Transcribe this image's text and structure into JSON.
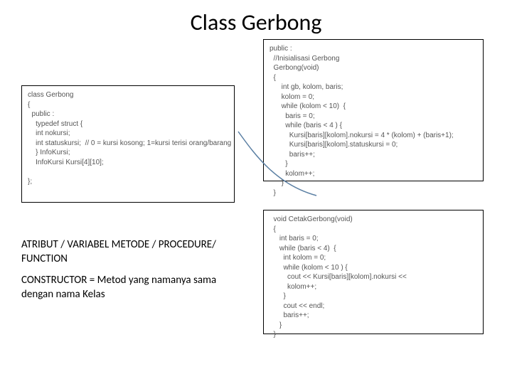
{
  "title": "Class Gerbong",
  "code_left": "class Gerbong\n{\n  public :\n    typedef struct {\n    int nokursi;\n    int statuskursi;  // 0 = kursi kosong; 1=kursi terisi orang/barang\n    } InfoKursi;\n    InfoKursi Kursi[4][10];\n\n};",
  "code_topright": "public :\n  //Inisialisasi Gerbong\n  Gerbong(void)\n  {\n      int gb, kolom, baris;\n      kolom = 0;\n      while (kolom < 10)  {\n        baris = 0;\n        while (baris < 4 ) {\n          Kursi[baris][kolom].nokursi = 4 * (kolom) + (baris+1);\n          Kursi[baris][kolom].statuskursi = 0;\n          baris++;\n        }\n        kolom++;\n      }\n  }",
  "code_botright": "  void CetakGerbong(void)\n  {\n     int baris = 0;\n     while (baris < 4)  {\n       int kolom = 0;\n       while (kolom < 10 ) {\n         cout << Kursi[baris][kolom].nokursi <<\n         kolom++;\n       }\n       cout << endl;\n       baris++;\n     }\n  }",
  "note1": "ATRIBUT / VARIABEL\nMETODE / PROCEDURE/ FUNCTION",
  "note2": "CONSTRUCTOR = Metod yang namanya sama dengan nama Kelas"
}
